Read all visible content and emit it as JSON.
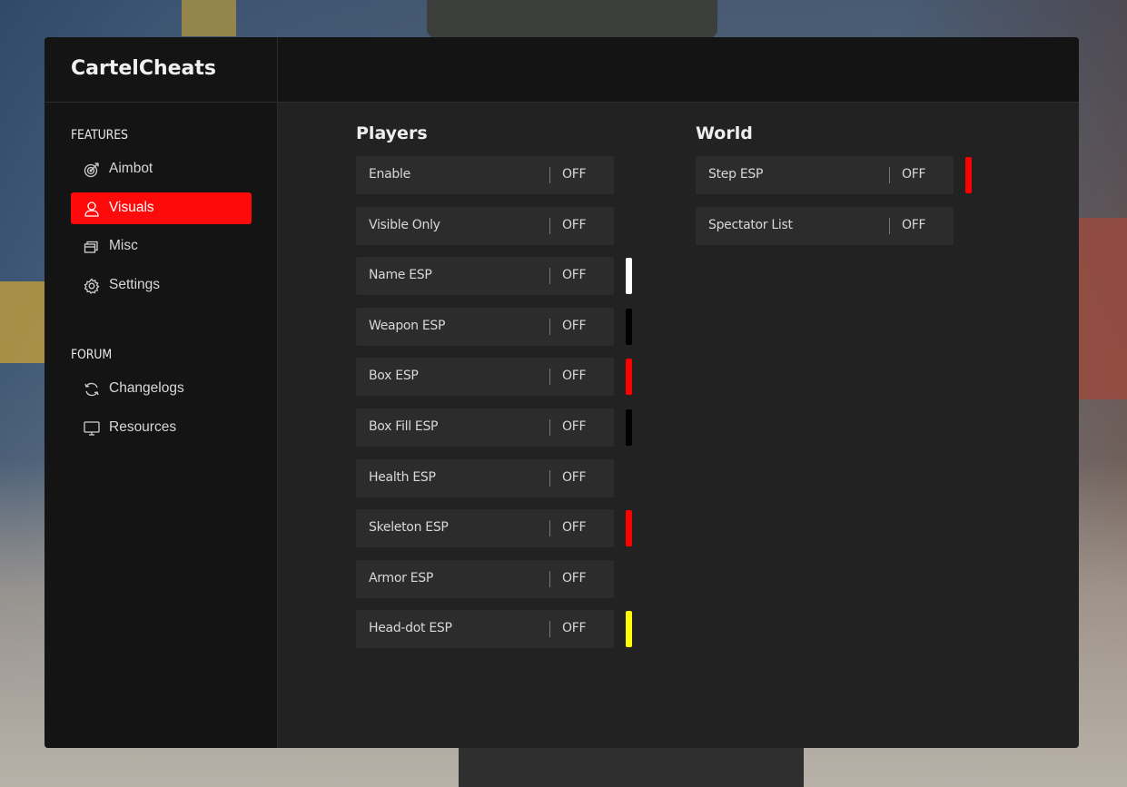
{
  "app": {
    "title": "CartelCheats"
  },
  "sidebar": {
    "features_label": "FEATURES",
    "forum_label": "FORUM",
    "features": [
      {
        "label": "Aimbot",
        "icon": "target-icon"
      },
      {
        "label": "Visuals",
        "icon": "user-icon",
        "active": true
      },
      {
        "label": "Misc",
        "icon": "layers-icon"
      },
      {
        "label": "Settings",
        "icon": "gear-icon"
      }
    ],
    "forum": [
      {
        "label": "Changelogs",
        "icon": "refresh-icon"
      },
      {
        "label": "Resources",
        "icon": "monitor-icon"
      }
    ]
  },
  "players": {
    "title": "Players",
    "options": [
      {
        "label": "Enable",
        "value": "OFF",
        "color": null
      },
      {
        "label": "Visible Only",
        "value": "OFF",
        "color": null
      },
      {
        "label": "Name ESP",
        "value": "OFF",
        "color": "#ffffff"
      },
      {
        "label": "Weapon ESP",
        "value": "OFF",
        "color": "#000000"
      },
      {
        "label": "Box ESP",
        "value": "OFF",
        "color": "#ff0000"
      },
      {
        "label": "Box Fill ESP",
        "value": "OFF",
        "color": "#000000"
      },
      {
        "label": "Health ESP",
        "value": "OFF",
        "color": null
      },
      {
        "label": "Skeleton ESP",
        "value": "OFF",
        "color": "#ff0000"
      },
      {
        "label": "Armor ESP",
        "value": "OFF",
        "color": null
      },
      {
        "label": "Head-dot ESP",
        "value": "OFF",
        "color": "#ffff00"
      }
    ]
  },
  "world": {
    "title": "World",
    "options": [
      {
        "label": "Step ESP",
        "value": "OFF",
        "color": "#ff0000"
      },
      {
        "label": "Spectator List",
        "value": "OFF",
        "color": null
      }
    ]
  },
  "theme": {
    "accent": "#ff0a0a"
  }
}
